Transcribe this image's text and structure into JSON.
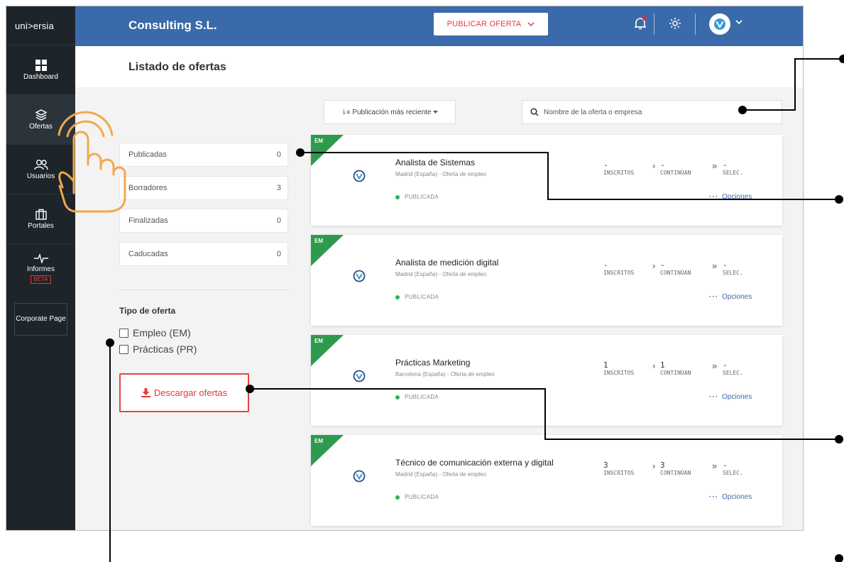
{
  "sidebar": {
    "brand": "uni>ersia",
    "items": [
      {
        "label": "Dashboard",
        "icon": "dashboard-icon"
      },
      {
        "label": "Ofertas",
        "icon": "layers-icon"
      },
      {
        "label": "Usuarios",
        "icon": "users-icon"
      },
      {
        "label": "Portales",
        "icon": "briefcase-icon"
      },
      {
        "label": "Informes",
        "icon": "pulse-icon",
        "badge": "BETA"
      }
    ],
    "corporate": "Corporate Page"
  },
  "topbar": {
    "company": "Consulting S.L.",
    "publish_label": "PUBLICAR OFERTA"
  },
  "page": {
    "title": "Listado de ofertas"
  },
  "filters": {
    "statuses": [
      {
        "label": "Publicadas",
        "count": "0"
      },
      {
        "label": "Borradores",
        "count": "3"
      },
      {
        "label": "Finalizadas",
        "count": "0"
      },
      {
        "label": "Caducadas",
        "count": "0"
      }
    ],
    "type_title": "Tipo de oferta",
    "types": [
      "Empleo (EM)",
      "Prácticas (PR)"
    ],
    "download_label": "Descargar ofertas"
  },
  "toolbar": {
    "sort_label": "Publicación más reciente",
    "search_placeholder": "Nombre de la oferta o empresa"
  },
  "offers": [
    {
      "tag": "EM",
      "title": "Analista de Sistemas",
      "subtitle": "Madrid (España) - Oferta de empleo",
      "status": "PUBLICADA",
      "inscritos": "-",
      "continuan": "-",
      "selec": "-",
      "options": "Opciones"
    },
    {
      "tag": "EM",
      "title": "Analista de medición digital",
      "subtitle": "Madrid (España) - Oferta de empleo",
      "status": "PUBLICADA",
      "inscritos": "-",
      "continuan": "-",
      "selec": "-",
      "options": "Opciones"
    },
    {
      "tag": "EM",
      "title": "Prácticas Marketing",
      "subtitle": "Barcelona (España) - Oferta de empleo",
      "status": "PUBLICADA",
      "inscritos": "1",
      "continuan": "1",
      "selec": "-",
      "options": "Opciones"
    },
    {
      "tag": "EM",
      "title": "Técnico de comunicación externa y digital",
      "subtitle": "Madrid (España) - Oferta de empleo",
      "status": "PUBLICADA",
      "inscritos": "3",
      "continuan": "3",
      "selec": "-",
      "options": "Opciones"
    }
  ],
  "stat_labels": {
    "inscritos": "INSCRITOS",
    "continuan": "CONTINÚAN",
    "selec": "SELEC."
  },
  "colors": {
    "topbar": "#3a6aa9",
    "sidebar": "#1d252b",
    "accent_red": "#e23b3b",
    "tag_green": "#2e9a4d",
    "status_green": "#2eb35b",
    "hand_orange": "#f2a84b"
  }
}
